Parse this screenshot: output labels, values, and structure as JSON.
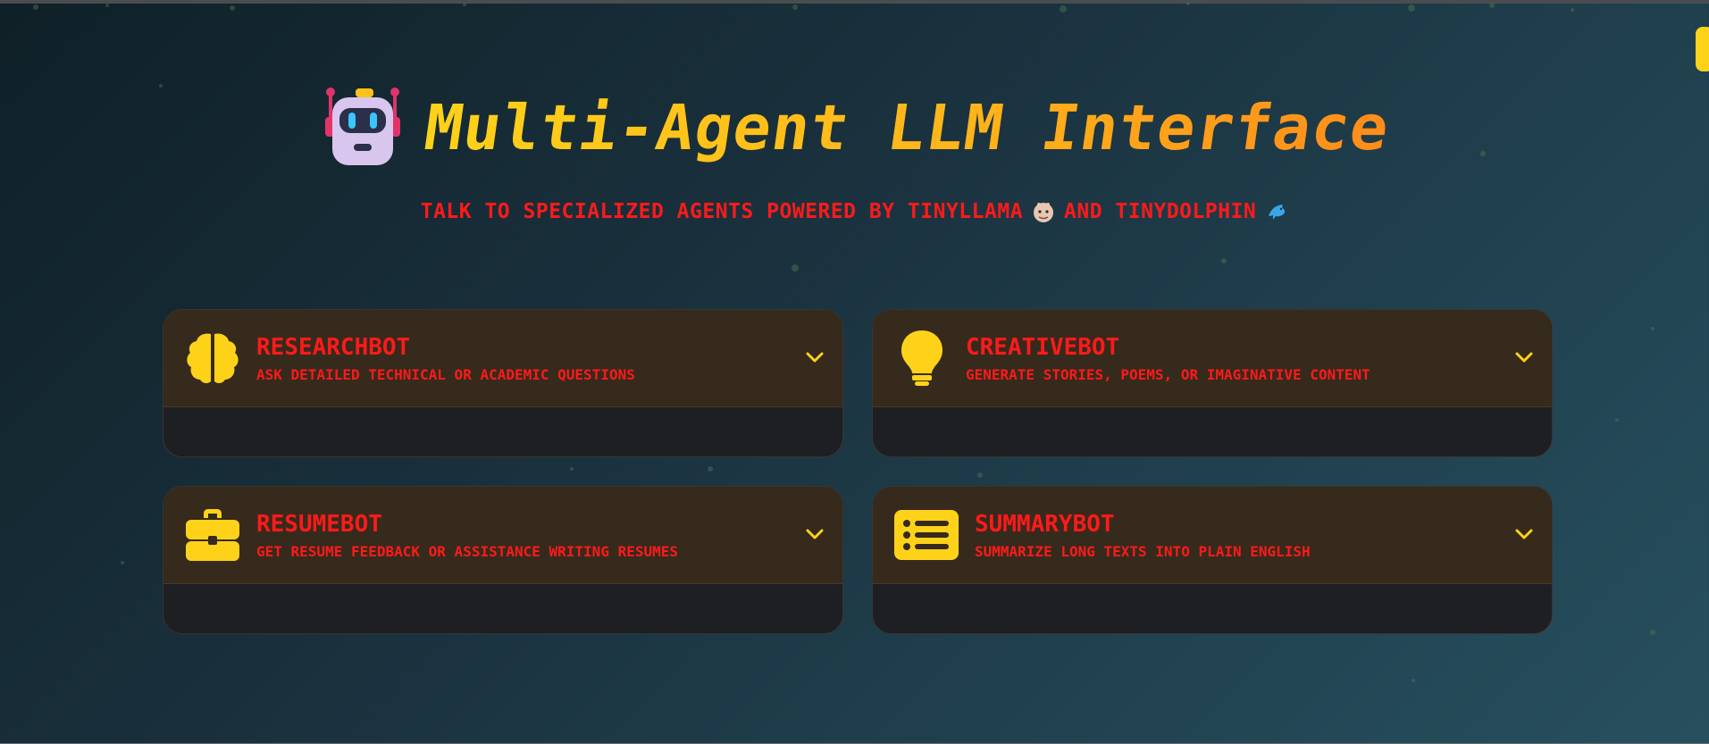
{
  "header": {
    "title": "Multi-Agent LLM Interface",
    "logo_icon": "robot-icon",
    "subtitle_pre": "TALK TO SPECIALIZED AGENTS POWERED BY TINYLLAMA",
    "subtitle_mid": "AND TINYDOLPHIN",
    "subtitle_icon_1": "llama-emoji-icon",
    "subtitle_icon_2": "dolphin-emoji-icon"
  },
  "colors": {
    "accent_yellow": "#ffd21a",
    "accent_orange": "#ff8c1a",
    "label_red": "#ff1a1a",
    "card_header_bg": "#362a1c",
    "card_body_bg": "#1d1f22"
  },
  "agents": [
    {
      "name": "RESEARCHBOT",
      "description": "ASK DETAILED TECHNICAL OR ACADEMIC QUESTIONS",
      "icon": "brain-icon"
    },
    {
      "name": "CREATIVEBOT",
      "description": "GENERATE STORIES, POEMS, OR IMAGINATIVE CONTENT",
      "icon": "lightbulb-icon"
    },
    {
      "name": "RESUMEBOT",
      "description": "GET RESUME FEEDBACK OR ASSISTANCE WRITING RESUMES",
      "icon": "briefcase-icon"
    },
    {
      "name": "SUMMARYBOT",
      "description": "SUMMARIZE LONG TEXTS INTO PLAIN ENGLISH",
      "icon": "list-icon"
    }
  ]
}
